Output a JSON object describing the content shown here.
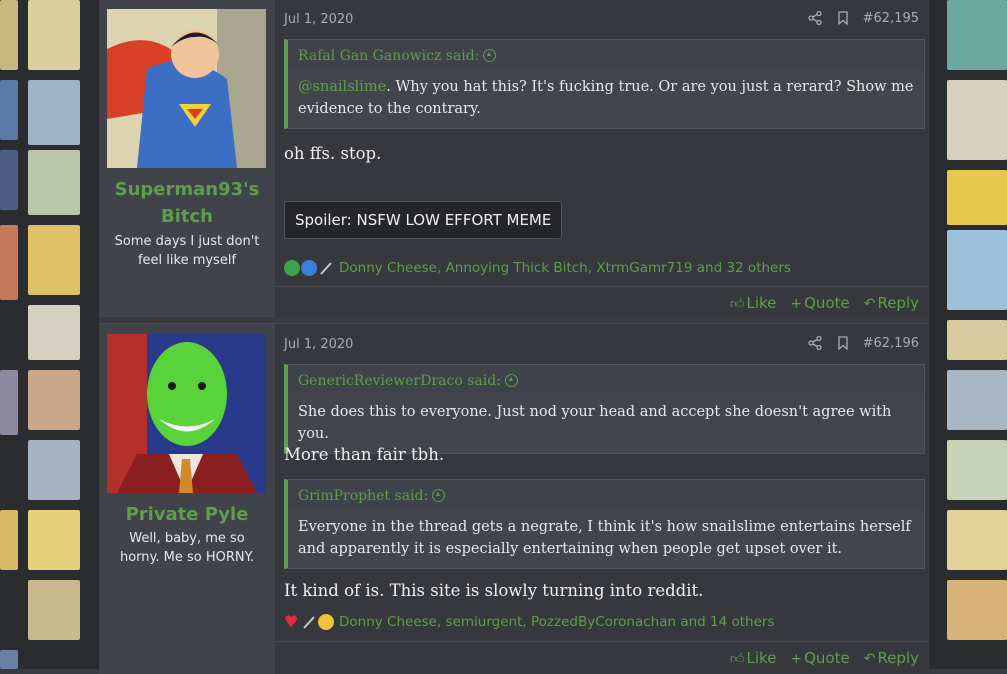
{
  "posts": [
    {
      "date": "Jul 1, 2020",
      "number": "#62,195",
      "username": "Superman93's Bitch",
      "user_title": "Some days I just don't feel like myself",
      "quotes": [
        {
          "author": "Rafal Gan Ganowicz said:",
          "mention": "@snailslime",
          "text": ". Why you hat this? It's fucking true. Or are you just a rerard? Show me evidence to the contrary."
        }
      ],
      "body": [
        "oh ffs. stop."
      ],
      "spoiler": "Spoiler: NSFW LOW EFFORT MEME",
      "reactions": "Donny Cheese, Annoying Thick Bitch, XtrmGamr719 and 32 others",
      "actions": {
        "like": "Like",
        "quote": "Quote",
        "reply": "Reply"
      }
    },
    {
      "date": "Jul 1, 2020",
      "number": "#62,196",
      "username": "Private Pyle",
      "user_title": "Well, baby, me so horny. Me so HORNY.",
      "quotes": [
        {
          "author": "GenericReviewerDraco said:",
          "mention": "",
          "text": "She does this to everyone. Just nod your head and accept she doesn't agree with you."
        },
        {
          "author": "GrimProphet said:",
          "mention": "",
          "text": "Everyone in the thread gets a negrate, I think it's how snailslime entertains herself and apparently it is especially entertaining when people get upset over it."
        }
      ],
      "body": [
        "More than fair tbh.",
        "It kind of is. This site is slowly turning into reddit."
      ],
      "reactions": "Donny Cheese, semiurgent, PozzedByCoronachan and 14 others",
      "actions": {
        "like": "Like",
        "quote": "Quote",
        "reply": "Reply"
      }
    }
  ],
  "colors": {
    "accent": "#5e9e4c",
    "panel": "#36383e",
    "user_panel": "#41434b"
  }
}
